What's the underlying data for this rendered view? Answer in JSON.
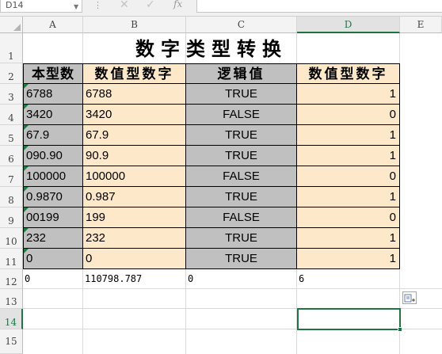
{
  "formula_bar": {
    "name_box": "D14",
    "fx_label": "fx",
    "formula": ""
  },
  "icons": {
    "cancel": "close-icon",
    "enter": "check-icon",
    "function": "fx-icon"
  },
  "columns": [
    "A",
    "B",
    "C",
    "D",
    "E"
  ],
  "rows": [
    "1",
    "2",
    "3",
    "4",
    "5",
    "6",
    "7",
    "8",
    "9",
    "10",
    "11",
    "12",
    "13",
    "14",
    "15"
  ],
  "selected_cell": {
    "column": "D",
    "row": "14"
  },
  "sheet": {
    "title": "数字类型转换",
    "headers": [
      "本型数",
      "数值型数字",
      "逻辑值",
      "数值型数字"
    ],
    "data_rows": [
      {
        "a": "6788",
        "b": "6788",
        "c": "TRUE",
        "d": "1"
      },
      {
        "a": "3420",
        "b": "3420",
        "c": "FALSE",
        "d": "0"
      },
      {
        "a": "67.9",
        "b": "67.9",
        "c": "TRUE",
        "d": "1"
      },
      {
        "a": "090.90",
        "b": "90.9",
        "c": "TRUE",
        "d": "1"
      },
      {
        "a": "100000",
        "b": "100000",
        "c": "FALSE",
        "d": "0"
      },
      {
        "a": "0.9870",
        "b": "0.987",
        "c": "TRUE",
        "d": "1"
      },
      {
        "a": "00199",
        "b": "199",
        "c": "FALSE",
        "d": "0"
      },
      {
        "a": "232",
        "b": "232",
        "c": "TRUE",
        "d": "1"
      },
      {
        "a": "0",
        "b": "0",
        "c": "TRUE",
        "d": "1"
      }
    ],
    "totals": {
      "a": "0",
      "b": "110798.787",
      "c": "0",
      "d": "6"
    }
  },
  "colors": {
    "header_and_text_col": "#c0c0c0",
    "value_col": "#fde9c9",
    "selection": "#217346",
    "error_indicator": "#1a7d3d"
  }
}
